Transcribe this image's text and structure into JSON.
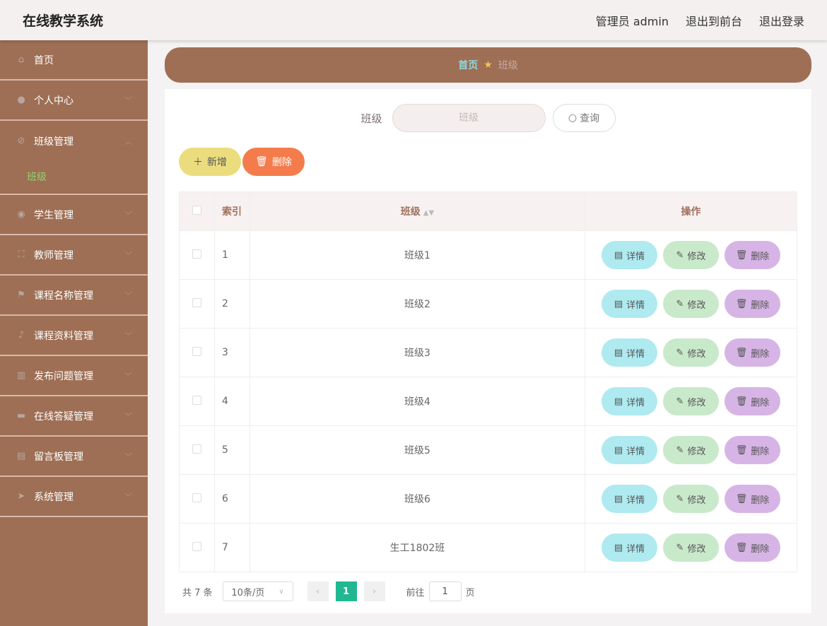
{
  "header": {
    "title": "在线教学系统",
    "user": "管理员 admin",
    "front": "退出到前台",
    "logout": "退出登录"
  },
  "sidebar": {
    "items": [
      {
        "label": "首页",
        "icon": "home-icon",
        "chev": false
      },
      {
        "label": "个人中心",
        "icon": "user-icon",
        "chev": true
      },
      {
        "label": "班级管理",
        "icon": "class-icon",
        "chev": true,
        "open": true,
        "sub": [
          "班级"
        ]
      },
      {
        "label": "学生管理",
        "icon": "student-icon",
        "chev": true
      },
      {
        "label": "教师管理",
        "icon": "teacher-icon",
        "chev": true
      },
      {
        "label": "课程名称管理",
        "icon": "flag-icon",
        "chev": true
      },
      {
        "label": "课程资料管理",
        "icon": "mic-icon",
        "chev": true
      },
      {
        "label": "发布问题管理",
        "icon": "chart-icon",
        "chev": true
      },
      {
        "label": "在线答疑管理",
        "icon": "ticket-icon",
        "chev": true
      },
      {
        "label": "留言板管理",
        "icon": "clipboard-icon",
        "chev": true
      },
      {
        "label": "系统管理",
        "icon": "send-icon",
        "chev": true
      }
    ]
  },
  "breadcrumb": {
    "home": "首页",
    "current": "班级"
  },
  "search": {
    "label": "班级",
    "placeholder": "班级",
    "button": "查询"
  },
  "actions": {
    "add": "新增",
    "delete": "删除"
  },
  "table": {
    "headers": {
      "index": "索引",
      "class": "班级",
      "ops": "操作"
    },
    "rows": [
      {
        "index": "1",
        "class": "班级1"
      },
      {
        "index": "2",
        "class": "班级2"
      },
      {
        "index": "3",
        "class": "班级3"
      },
      {
        "index": "4",
        "class": "班级4"
      },
      {
        "index": "5",
        "class": "班级5"
      },
      {
        "index": "6",
        "class": "班级6"
      },
      {
        "index": "7",
        "class": "生工1802班"
      }
    ],
    "ops": {
      "detail": "详情",
      "edit": "修改",
      "delete": "删除"
    }
  },
  "pagination": {
    "total": "共 7 条",
    "page_size": "10条/页",
    "current": "1",
    "goto_label": "前往",
    "goto_value": "1",
    "page_suffix": "页"
  }
}
